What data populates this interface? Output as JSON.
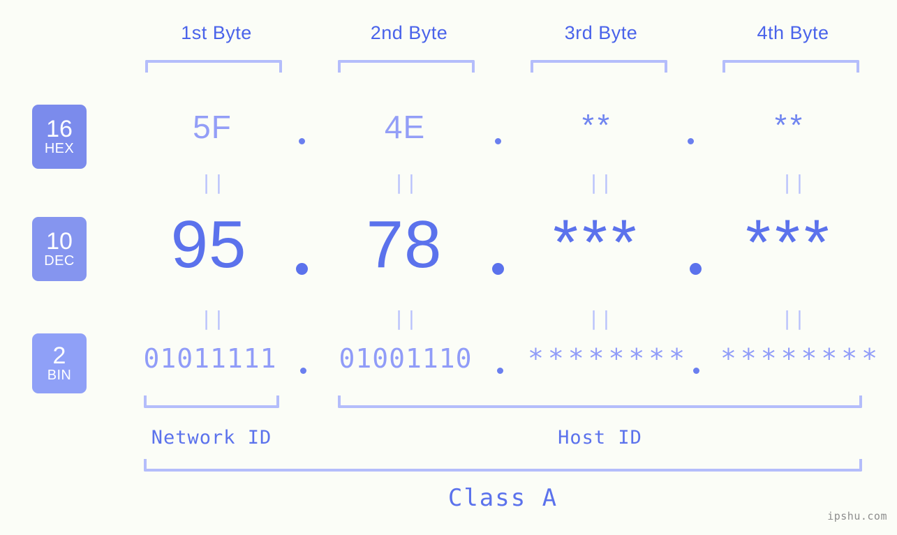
{
  "background_color": "#fbfdf7",
  "accent_color": "#5b72ec",
  "headers": [
    {
      "label": "1st Byte"
    },
    {
      "label": "2nd Byte"
    },
    {
      "label": "3rd Byte"
    },
    {
      "label": "4th Byte"
    }
  ],
  "bases": [
    {
      "number": "16",
      "abbr": "HEX",
      "color": "#7b8bec"
    },
    {
      "number": "10",
      "abbr": "DEC",
      "color": "#8595ef"
    },
    {
      "number": "2",
      "abbr": "BIN",
      "color": "#8fa0f7"
    }
  ],
  "rows": {
    "hex": {
      "base": "16",
      "name": "HEX",
      "values": [
        "5F",
        "4E",
        "**",
        "**"
      ],
      "separator": "."
    },
    "dec": {
      "base": "10",
      "name": "DEC",
      "values": [
        "95",
        "78",
        "***",
        "***"
      ],
      "separator": "."
    },
    "bin": {
      "base": "2",
      "name": "BIN",
      "values": [
        "01011111",
        "01001110",
        "********",
        "********"
      ],
      "separator": "."
    }
  },
  "equality_marks": {
    "symbol": "||",
    "count_per_row": 4,
    "rows": 2
  },
  "segments": [
    {
      "label": "Network ID",
      "bytes": "1"
    },
    {
      "label": "Host ID",
      "bytes": "2-4"
    }
  ],
  "class": {
    "label": "Class A"
  },
  "watermark": {
    "text": "ipshu.com"
  },
  "address": {
    "hex": "5F.4E.**.**",
    "dec": "95.78.***.***",
    "bin": "01011111.01001110.********.********"
  }
}
